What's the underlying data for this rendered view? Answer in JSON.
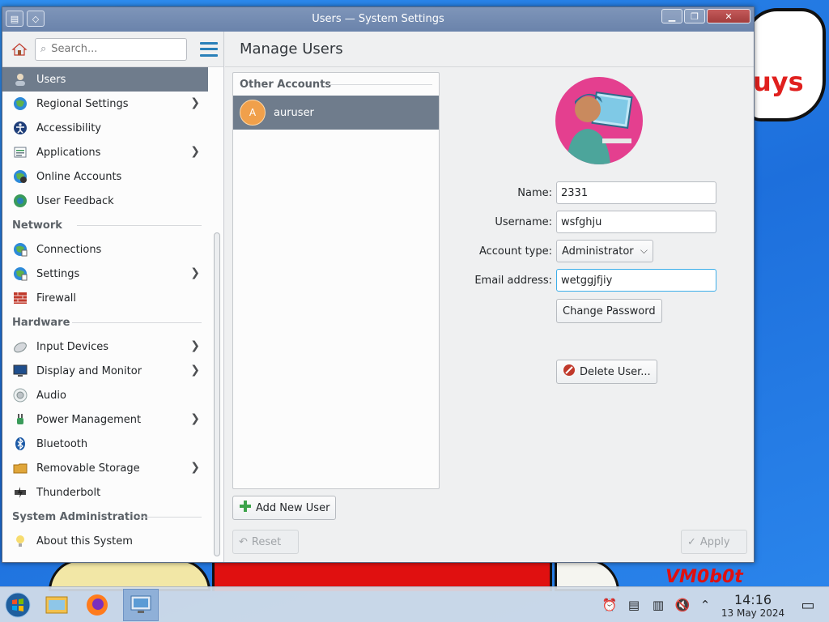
{
  "window": {
    "title": "Users — System Settings"
  },
  "sidebar": {
    "search_placeholder": "Search...",
    "items": [
      {
        "label": "Users"
      },
      {
        "label": "Regional Settings"
      },
      {
        "label": "Accessibility"
      },
      {
        "label": "Applications"
      },
      {
        "label": "Online Accounts"
      },
      {
        "label": "User Feedback"
      },
      {
        "label": "Connections"
      },
      {
        "label": "Settings"
      },
      {
        "label": "Firewall"
      },
      {
        "label": "Input Devices"
      },
      {
        "label": "Display and Monitor"
      },
      {
        "label": "Audio"
      },
      {
        "label": "Power Management"
      },
      {
        "label": "Bluetooth"
      },
      {
        "label": "Removable Storage"
      },
      {
        "label": "Thunderbolt"
      },
      {
        "label": "About this System"
      }
    ],
    "sections": {
      "network": "Network",
      "hardware": "Hardware",
      "sysadmin": "System Administration"
    }
  },
  "main": {
    "title": "Manage Users",
    "accounts_header": "Other Accounts",
    "accounts": [
      {
        "initial": "A",
        "name": "auruser"
      }
    ],
    "add_user_label": "Add New User",
    "reset_label": "Reset",
    "apply_label": "Apply",
    "form": {
      "name_label": "Name:",
      "name_value": "2331",
      "username_label": "Username:",
      "username_value": "wsfghju",
      "account_type_label": "Account type:",
      "account_type_value": "Administrator",
      "email_label": "Email address:",
      "email_value": "wetggjfjiy",
      "change_password_label": "Change Password",
      "delete_user_label": "Delete User..."
    }
  },
  "desktop": {
    "cloud_text": "uys",
    "watermark": "VM0b0t"
  },
  "taskbar": {
    "time": "14:16",
    "date": "13 May 2024"
  },
  "colors": {
    "accent": "#3daee9",
    "selection": "#6f7c8c",
    "titlebar": "#7289b1"
  }
}
